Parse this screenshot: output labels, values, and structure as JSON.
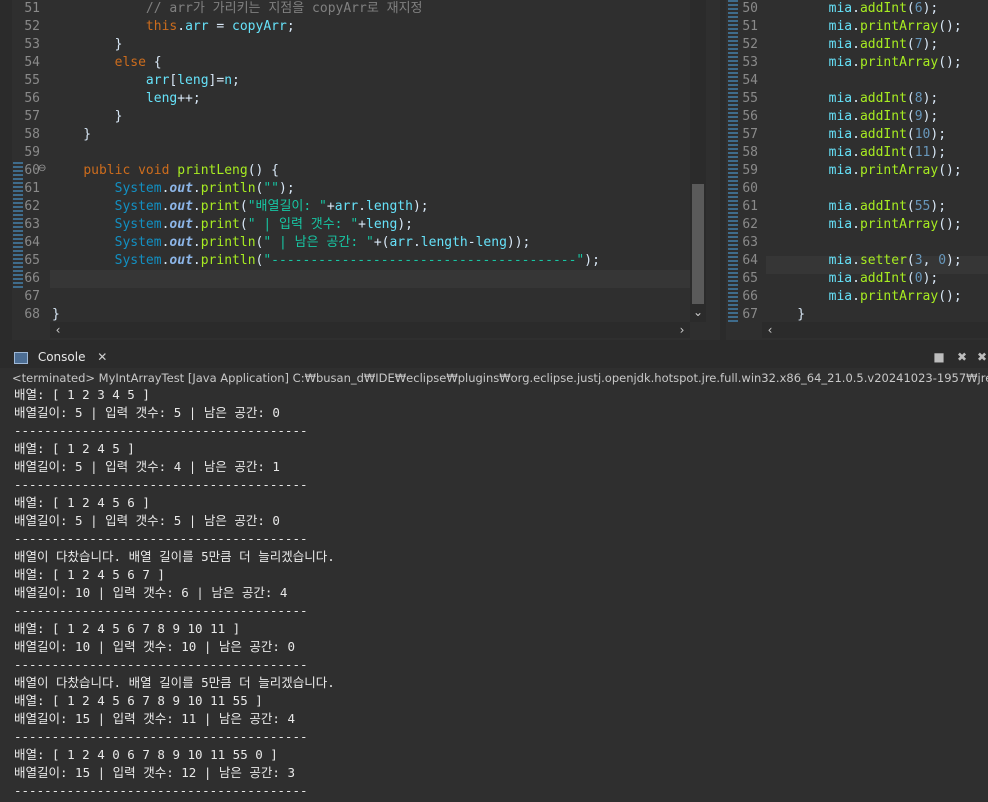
{
  "editor_left": {
    "lines": [
      {
        "n": "51",
        "code": "            // arr가 가리키는 지점을 copyArr로 재지정"
      },
      {
        "n": "52",
        "code": "            this.arr = copyArr;"
      },
      {
        "n": "53",
        "code": "        }"
      },
      {
        "n": "54",
        "code": "        else {"
      },
      {
        "n": "55",
        "code": "            arr[leng]=n;"
      },
      {
        "n": "56",
        "code": "            leng++;"
      },
      {
        "n": "57",
        "code": "        }"
      },
      {
        "n": "58",
        "code": "    }"
      },
      {
        "n": "59",
        "code": ""
      },
      {
        "n": "60",
        "code": "    public void printLeng() {"
      },
      {
        "n": "61",
        "code": "        System.out.println(\"\");"
      },
      {
        "n": "62",
        "code": "        System.out.print(\"배열길이: \"+arr.length);"
      },
      {
        "n": "63",
        "code": "        System.out.print(\" | 입력 갯수: \"+leng);"
      },
      {
        "n": "64",
        "code": "        System.out.println(\" | 남은 공간: \"+(arr.length-leng));"
      },
      {
        "n": "65",
        "code": "        System.out.println(\"---------------------------------------\");"
      },
      {
        "n": "66",
        "code": "    }"
      },
      {
        "n": "67",
        "code": ""
      },
      {
        "n": "68",
        "code": "}"
      }
    ]
  },
  "editor_right": {
    "lines": [
      {
        "n": "50",
        "code": "        mia.addInt(6);"
      },
      {
        "n": "51",
        "code": "        mia.printArray();"
      },
      {
        "n": "52",
        "code": "        mia.addInt(7);"
      },
      {
        "n": "53",
        "code": "        mia.printArray();"
      },
      {
        "n": "54",
        "code": ""
      },
      {
        "n": "55",
        "code": "        mia.addInt(8);"
      },
      {
        "n": "56",
        "code": "        mia.addInt(9);"
      },
      {
        "n": "57",
        "code": "        mia.addInt(10);"
      },
      {
        "n": "58",
        "code": "        mia.addInt(11);"
      },
      {
        "n": "59",
        "code": "        mia.printArray();"
      },
      {
        "n": "60",
        "code": ""
      },
      {
        "n": "61",
        "code": "        mia.addInt(55);"
      },
      {
        "n": "62",
        "code": "        mia.printArray();"
      },
      {
        "n": "63",
        "code": ""
      },
      {
        "n": "64",
        "code": "        mia.setter(3, 0);"
      },
      {
        "n": "65",
        "code": "        mia.addInt(0);"
      },
      {
        "n": "66",
        "code": "        mia.printArray();"
      },
      {
        "n": "67",
        "code": "    }"
      }
    ]
  },
  "console": {
    "tab_label": "Console",
    "status": "<terminated> MyIntArrayTest [Java Application] C:₩busan_d₩IDE₩eclipse₩plugins₩org.eclipse.justj.openjdk.hotspot.jre.full.win32.x86_64_21.0.5.v20241023-1957₩jre₩bin₩javaw.ex",
    "output": [
      "배열: [ 1 2 3 4 5 ]",
      "배열길이: 5 | 입력 갯수: 5 | 남은 공간: 0",
      "---------------------------------------",
      "배열: [ 1 2 4 5 ]",
      "배열길이: 5 | 입력 갯수: 4 | 남은 공간: 1",
      "---------------------------------------",
      "배열: [ 1 2 4 5 6 ]",
      "배열길이: 5 | 입력 갯수: 5 | 남은 공간: 0",
      "---------------------------------------",
      "배열이 다찼습니다. 배열 길이를 5만큼 더 늘리겠습니다.",
      "배열: [ 1 2 4 5 6 7 ]",
      "배열길이: 10 | 입력 갯수: 6 | 남은 공간: 4",
      "---------------------------------------",
      "배열: [ 1 2 4 5 6 7 8 9 10 11 ]",
      "배열길이: 10 | 입력 갯수: 10 | 남은 공간: 0",
      "---------------------------------------",
      "배열이 다찼습니다. 배열 길이를 5만큼 더 늘리겠습니다.",
      "배열: [ 1 2 4 5 6 7 8 9 10 11 55 ]",
      "배열길이: 15 | 입력 갯수: 11 | 남은 공간: 4",
      "---------------------------------------",
      "배열: [ 1 2 4 0 6 7 8 9 10 11 55 0 ]",
      "배열길이: 15 | 입력 갯수: 12 | 남은 공간: 3",
      "---------------------------------------"
    ]
  }
}
